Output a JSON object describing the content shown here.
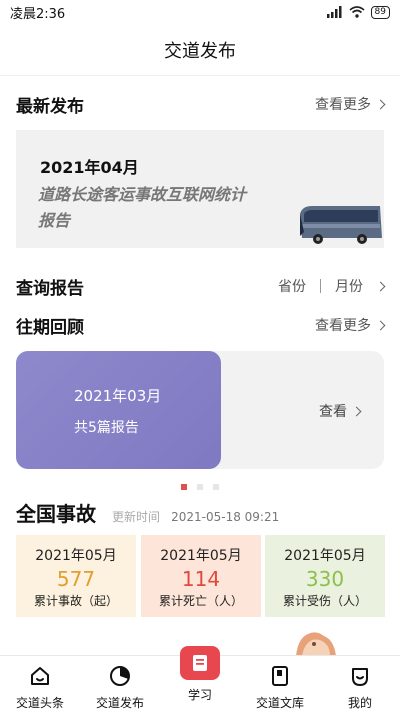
{
  "status_bar": {
    "time": "凌晨2:36",
    "battery": "89"
  },
  "header": {
    "title": "交道发布"
  },
  "latest": {
    "title": "最新发布",
    "more_label": "查看更多",
    "banner": {
      "date": "2021年04月",
      "heading": "道路长途客运事故互联网统计报告"
    }
  },
  "query": {
    "title": "查询报告",
    "filters": [
      "省份",
      "月份"
    ]
  },
  "history": {
    "title": "往期回顾",
    "more_label": "查看更多",
    "card": {
      "date": "2021年03月",
      "count": "共5篇报告",
      "view_label": "查看"
    },
    "carousel_dots": 3,
    "active_dot": 0
  },
  "national": {
    "title": "全国事故",
    "update_label": "更新时间",
    "update_time": "2021-05-18 09:21",
    "stats": [
      {
        "date": "2021年05月",
        "value": "577",
        "label": "累计事故（起）",
        "bg": "#fdf1e0",
        "color": "#e0a030"
      },
      {
        "date": "2021年05月",
        "value": "114",
        "label": "累计死亡（人）",
        "bg": "#fde5da",
        "color": "#e04a3c"
      },
      {
        "date": "2021年05月",
        "value": "330",
        "label": "累计受伤（人）",
        "bg": "#eaf1de",
        "color": "#8cc04a"
      }
    ]
  },
  "tabbar": {
    "items": [
      {
        "label": "交道头条",
        "icon": "home-icon"
      },
      {
        "label": "交道发布",
        "icon": "pie-chart-icon"
      },
      {
        "label": "学习",
        "icon": "study-icon"
      },
      {
        "label": "交道文库",
        "icon": "library-icon"
      },
      {
        "label": "我的",
        "icon": "profile-icon"
      }
    ]
  },
  "colors": {
    "accent": "#e8474f",
    "history_card": "#8580c8"
  }
}
